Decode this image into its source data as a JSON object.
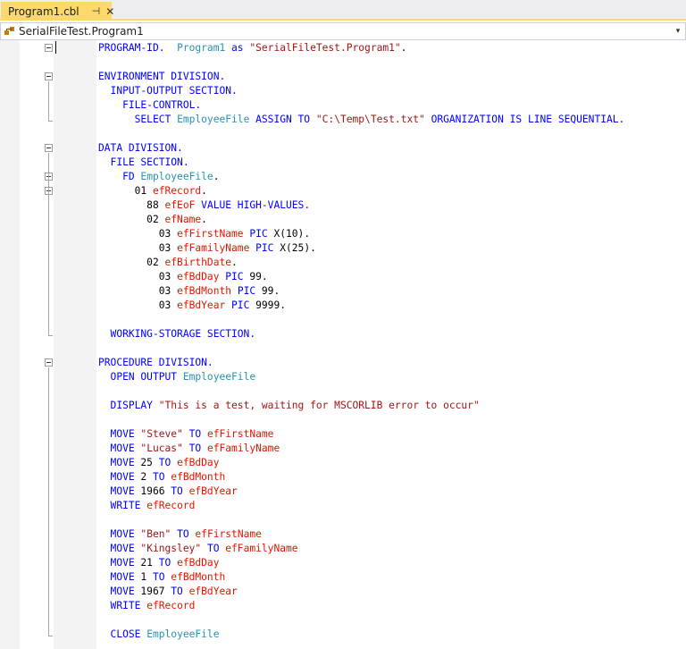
{
  "tab": {
    "title": "Program1.cbl",
    "pin_glyph": "⊣",
    "close_glyph": "✕"
  },
  "navbar": {
    "class_name": "SerialFileTest.Program1",
    "dropdown_glyph": "▾"
  },
  "code_lines": [
    [
      [
        "kw",
        "PROGRAM-ID."
      ],
      [
        "",
        "  "
      ],
      [
        "id",
        "Program1"
      ],
      [
        "",
        " "
      ],
      [
        "kw",
        "as"
      ],
      [
        "",
        " "
      ],
      [
        "str",
        "\"SerialFileTest.Program1\""
      ],
      [
        "",
        "."
      ]
    ],
    [],
    [
      [
        "kw",
        "ENVIRONMENT DIVISION."
      ]
    ],
    [
      [
        "",
        "  "
      ],
      [
        "kw",
        "INPUT-OUTPUT SECTION."
      ]
    ],
    [
      [
        "",
        "    "
      ],
      [
        "kw",
        "FILE-CONTROL."
      ]
    ],
    [
      [
        "",
        "      "
      ],
      [
        "kw",
        "SELECT"
      ],
      [
        "",
        " "
      ],
      [
        "id",
        "EmployeeFile"
      ],
      [
        "",
        " "
      ],
      [
        "kw",
        "ASSIGN TO"
      ],
      [
        "",
        " "
      ],
      [
        "str",
        "\"C:\\Temp\\Test.txt\""
      ],
      [
        "",
        " "
      ],
      [
        "kw",
        "ORGANIZATION IS LINE SEQUENTIAL."
      ]
    ],
    [],
    [
      [
        "kw",
        "DATA DIVISION."
      ]
    ],
    [
      [
        "",
        "  "
      ],
      [
        "kw",
        "FILE SECTION."
      ]
    ],
    [
      [
        "",
        "    "
      ],
      [
        "kw",
        "FD"
      ],
      [
        "",
        " "
      ],
      [
        "id",
        "EmployeeFile"
      ],
      [
        "",
        "."
      ]
    ],
    [
      [
        "",
        "      01 "
      ],
      [
        "var",
        "efRecord"
      ],
      [
        "",
        "."
      ]
    ],
    [
      [
        "",
        "        88 "
      ],
      [
        "var",
        "efEoF"
      ],
      [
        "",
        " "
      ],
      [
        "kw",
        "VALUE HIGH-VALUES."
      ]
    ],
    [
      [
        "",
        "        02 "
      ],
      [
        "var",
        "efName"
      ],
      [
        "",
        "."
      ]
    ],
    [
      [
        "",
        "          03 "
      ],
      [
        "var",
        "efFirstName"
      ],
      [
        "",
        " "
      ],
      [
        "kw",
        "PIC"
      ],
      [
        "",
        " X(10)."
      ]
    ],
    [
      [
        "",
        "          03 "
      ],
      [
        "var",
        "efFamilyName"
      ],
      [
        "",
        " "
      ],
      [
        "kw",
        "PIC"
      ],
      [
        "",
        " X(25)."
      ]
    ],
    [
      [
        "",
        "        02 "
      ],
      [
        "var",
        "efBirthDate"
      ],
      [
        "",
        "."
      ]
    ],
    [
      [
        "",
        "          03 "
      ],
      [
        "var",
        "efBdDay"
      ],
      [
        "",
        " "
      ],
      [
        "kw",
        "PIC"
      ],
      [
        "",
        " 99."
      ]
    ],
    [
      [
        "",
        "          03 "
      ],
      [
        "var",
        "efBdMonth"
      ],
      [
        "",
        " "
      ],
      [
        "kw",
        "PIC"
      ],
      [
        "",
        " 99."
      ]
    ],
    [
      [
        "",
        "          03 "
      ],
      [
        "var",
        "efBdYear"
      ],
      [
        "",
        " "
      ],
      [
        "kw",
        "PIC"
      ],
      [
        "",
        " 9999."
      ]
    ],
    [],
    [
      [
        "",
        "  "
      ],
      [
        "kw",
        "WORKING-STORAGE SECTION."
      ]
    ],
    [],
    [
      [
        "kw",
        "PROCEDURE DIVISION."
      ]
    ],
    [
      [
        "",
        "  "
      ],
      [
        "kw",
        "OPEN OUTPUT"
      ],
      [
        "",
        " "
      ],
      [
        "id",
        "EmployeeFile"
      ]
    ],
    [],
    [
      [
        "",
        "  "
      ],
      [
        "kw",
        "DISPLAY"
      ],
      [
        "",
        " "
      ],
      [
        "str",
        "\"This is a test, waiting for MSCORLIB error to occur\""
      ]
    ],
    [],
    [
      [
        "",
        "  "
      ],
      [
        "kw",
        "MOVE"
      ],
      [
        "",
        " "
      ],
      [
        "str",
        "\"Steve\""
      ],
      [
        "",
        " "
      ],
      [
        "kw",
        "TO"
      ],
      [
        "",
        " "
      ],
      [
        "var",
        "efFirstName"
      ]
    ],
    [
      [
        "",
        "  "
      ],
      [
        "kw",
        "MOVE"
      ],
      [
        "",
        " "
      ],
      [
        "str",
        "\"Lucas\""
      ],
      [
        "",
        " "
      ],
      [
        "kw",
        "TO"
      ],
      [
        "",
        " "
      ],
      [
        "var",
        "efFamilyName"
      ]
    ],
    [
      [
        "",
        "  "
      ],
      [
        "kw",
        "MOVE"
      ],
      [
        "",
        " 25 "
      ],
      [
        "kw",
        "TO"
      ],
      [
        "",
        " "
      ],
      [
        "var",
        "efBdDay"
      ]
    ],
    [
      [
        "",
        "  "
      ],
      [
        "kw",
        "MOVE"
      ],
      [
        "",
        " 2 "
      ],
      [
        "kw",
        "TO"
      ],
      [
        "",
        " "
      ],
      [
        "var",
        "efBdMonth"
      ]
    ],
    [
      [
        "",
        "  "
      ],
      [
        "kw",
        "MOVE"
      ],
      [
        "",
        " 1966 "
      ],
      [
        "kw",
        "TO"
      ],
      [
        "",
        " "
      ],
      [
        "var",
        "efBdYear"
      ]
    ],
    [
      [
        "",
        "  "
      ],
      [
        "kw",
        "WRITE"
      ],
      [
        "",
        " "
      ],
      [
        "var",
        "efRecord"
      ]
    ],
    [],
    [
      [
        "",
        "  "
      ],
      [
        "kw",
        "MOVE"
      ],
      [
        "",
        " "
      ],
      [
        "str",
        "\"Ben\""
      ],
      [
        "",
        " "
      ],
      [
        "kw",
        "TO"
      ],
      [
        "",
        " "
      ],
      [
        "var",
        "efFirstName"
      ]
    ],
    [
      [
        "",
        "  "
      ],
      [
        "kw",
        "MOVE"
      ],
      [
        "",
        " "
      ],
      [
        "str",
        "\"Kingsley\""
      ],
      [
        "",
        " "
      ],
      [
        "kw",
        "TO"
      ],
      [
        "",
        " "
      ],
      [
        "var",
        "efFamilyName"
      ]
    ],
    [
      [
        "",
        "  "
      ],
      [
        "kw",
        "MOVE"
      ],
      [
        "",
        " 21 "
      ],
      [
        "kw",
        "TO"
      ],
      [
        "",
        " "
      ],
      [
        "var",
        "efBdDay"
      ]
    ],
    [
      [
        "",
        "  "
      ],
      [
        "kw",
        "MOVE"
      ],
      [
        "",
        " 1 "
      ],
      [
        "kw",
        "TO"
      ],
      [
        "",
        " "
      ],
      [
        "var",
        "efBdMonth"
      ]
    ],
    [
      [
        "",
        "  "
      ],
      [
        "kw",
        "MOVE"
      ],
      [
        "",
        " 1967 "
      ],
      [
        "kw",
        "TO"
      ],
      [
        "",
        " "
      ],
      [
        "var",
        "efBdYear"
      ]
    ],
    [
      [
        "",
        "  "
      ],
      [
        "kw",
        "WRITE"
      ],
      [
        "",
        " "
      ],
      [
        "var",
        "efRecord"
      ]
    ],
    [],
    [
      [
        "",
        "  "
      ],
      [
        "kw",
        "CLOSE"
      ],
      [
        "",
        " "
      ],
      [
        "id",
        "EmployeeFile"
      ]
    ]
  ],
  "fold_lines": [
    0,
    2,
    7,
    9,
    10,
    22
  ],
  "colors": {
    "keyword": "#0000ff",
    "string": "#a31515",
    "identifier": "#2b91af",
    "variable": "#e51400",
    "tab_active": "#fcd96a"
  }
}
